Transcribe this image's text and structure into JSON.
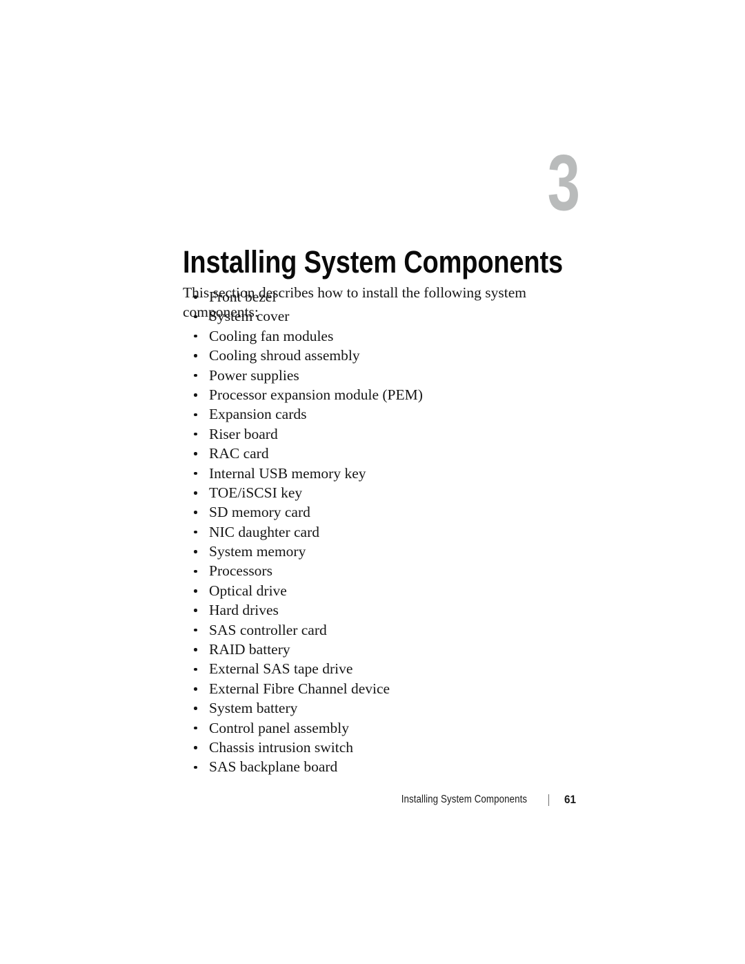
{
  "document": {
    "type": "manual-page",
    "background_color": "#ffffff",
    "text_color": "#161616"
  },
  "chapter": {
    "number": "3",
    "number_color": "#b9bbbb",
    "title": "Installing System Components"
  },
  "body": {
    "intro": "This section describes how to install the following system components:",
    "bullet_glyph": "•",
    "components": [
      "Front bezel",
      "System cover",
      "Cooling fan modules",
      "Cooling shroud assembly",
      "Power supplies",
      "Processor expansion module (PEM)",
      "Expansion cards",
      "Riser board",
      "RAC card",
      "Internal USB memory key",
      "TOE/iSCSI key",
      "SD memory card",
      "NIC daughter card",
      "System memory",
      "Processors",
      "Optical drive",
      "Hard drives",
      "SAS controller card",
      "RAID battery",
      "External SAS tape drive",
      "External Fibre Channel device",
      "System battery",
      "Control panel assembly",
      "Chassis intrusion switch",
      "SAS backplane board"
    ]
  },
  "footer": {
    "chapter_title": "Installing System Components",
    "separator": "|",
    "page_number": "61"
  }
}
